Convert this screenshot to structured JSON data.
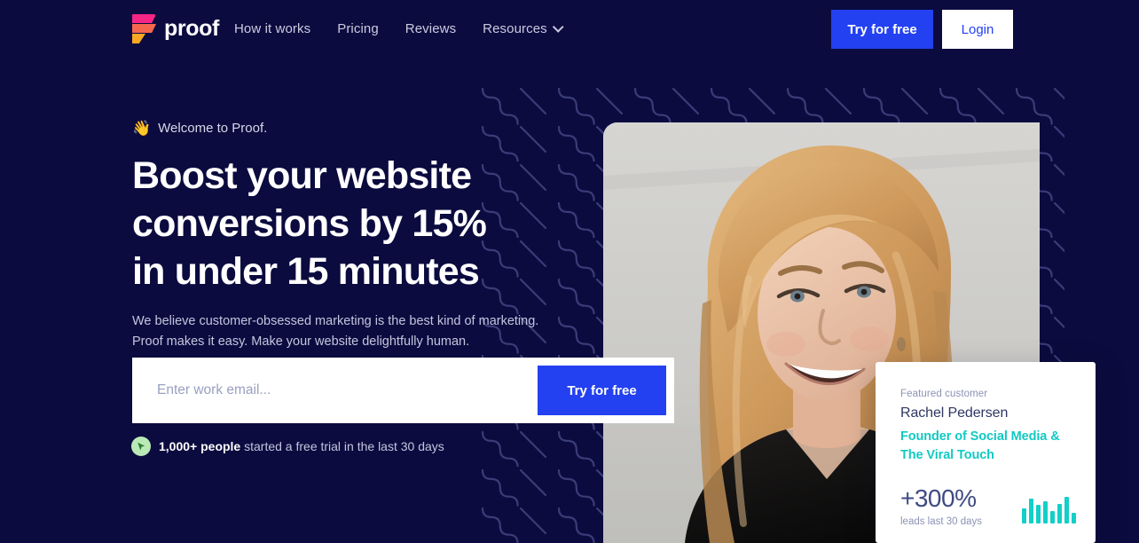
{
  "theme": {
    "bg": "#0b0b3f",
    "accent_blue": "#2341f0",
    "teal": "#12c9c3",
    "navy_text": "#2f3663",
    "muted": "#8c92b5",
    "logo_pink": "#f72585",
    "logo_salmon": "#f4674e",
    "logo_orange": "#f9a825",
    "badge_green": "#b9eab6"
  },
  "header": {
    "brand": "proof",
    "nav": [
      {
        "label": "How it works",
        "has_dropdown": false
      },
      {
        "label": "Pricing",
        "has_dropdown": false
      },
      {
        "label": "Reviews",
        "has_dropdown": false
      },
      {
        "label": "Resources",
        "has_dropdown": true
      }
    ],
    "try_label": "Try for free",
    "login_label": "Login"
  },
  "hero": {
    "eyebrow_emoji": "👋",
    "eyebrow": "Welcome to Proof.",
    "headline": "Boost your website conversions by 15% in under 15 minutes",
    "subtext": "We believe customer-obsessed marketing is the best kind of marketing. Proof makes it easy. Make your website delightfully human.",
    "email_placeholder": "Enter work email...",
    "email_value": "",
    "cta_label": "Try for free",
    "social_proof_strong": "1,000+ people",
    "social_proof_rest": "started a free trial in the last 30 days"
  },
  "featured_card": {
    "label": "Featured customer",
    "name": "Rachel Pedersen",
    "role_line_1": "Founder of Social Media &",
    "role_line_2": "The Viral Touch",
    "metric": "+300%",
    "metric_sub": "leads last 30 days",
    "sparkline": [
      58,
      92,
      70,
      84,
      45,
      72,
      100,
      40
    ]
  }
}
